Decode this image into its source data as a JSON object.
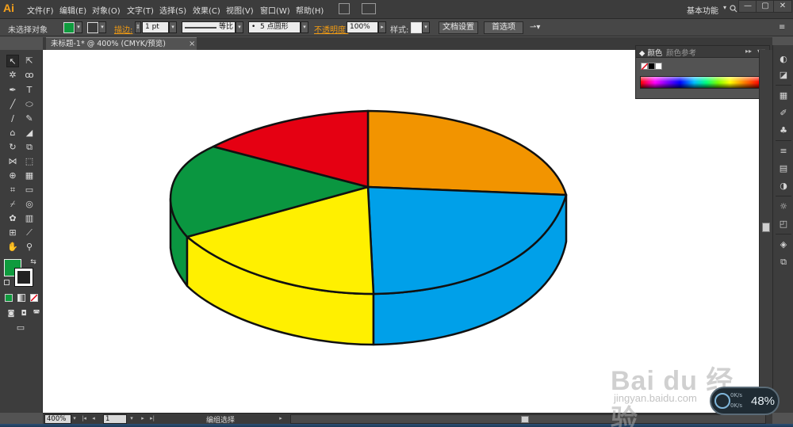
{
  "app": {
    "logo": "Ai",
    "menus": [
      "文件(F)",
      "编辑(E)",
      "对象(O)",
      "文字(T)",
      "选择(S)",
      "效果(C)",
      "视图(V)",
      "窗口(W)",
      "帮助(H)"
    ],
    "workspace_label": "基本功能",
    "window_buttons": [
      "—",
      "▢",
      "✕"
    ]
  },
  "control_bar": {
    "selection_status": "未选择对象",
    "stroke_label": "描边:",
    "stroke_weight": "1 pt",
    "stroke_profile": "等比",
    "brush": "5 点圆形",
    "opacity_label": "不透明度:",
    "opacity_value": "100%",
    "style_label": "样式:",
    "doc_setup_button": "文档设置",
    "preferences_button": "首选项"
  },
  "document_tab": {
    "title": "未标题-1* @ 400% (CMYK/预览)",
    "close": "×"
  },
  "status_bar": {
    "zoom": "400%",
    "artboard": "1",
    "status_text": "编组选择"
  },
  "color_panel": {
    "tab_active": "颜色",
    "tab_inactive": "颜色参考",
    "collapse": "▸▸",
    "menu": "▾≡"
  },
  "colors": {
    "fill": "#0f9b3e",
    "stroke": "#222222",
    "pie_orange": "#f29400",
    "pie_blue": "#00a0e9",
    "pie_yellow": "#fff000",
    "pie_green": "#0a9640",
    "pie_red": "#e50012"
  },
  "pie_slices": [
    {
      "name": "orange",
      "color": "#f29400"
    },
    {
      "name": "blue",
      "color": "#00a0e9"
    },
    {
      "name": "yellow",
      "color": "#fff000"
    },
    {
      "name": "green",
      "color": "#0a9640"
    },
    {
      "name": "red",
      "color": "#e50012"
    }
  ],
  "overlay": {
    "watermark_main": "Bai du 经验",
    "watermark_url": "jingyan.baidu.com",
    "net_speed_percent": "48%",
    "net_up": "0K/s",
    "net_down": "0K/s"
  }
}
